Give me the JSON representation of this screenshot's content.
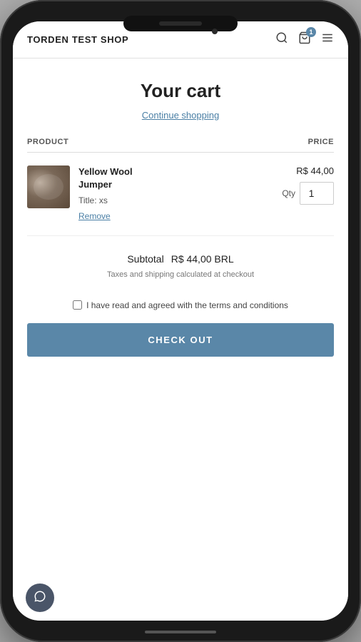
{
  "phone": {
    "speaker_aria": "speaker"
  },
  "header": {
    "logo": "TORDEN TEST SHOP",
    "cart_count": "1",
    "search_aria": "search",
    "cart_aria": "cart",
    "menu_aria": "menu"
  },
  "page": {
    "title": "Your cart",
    "continue_shopping": "Continue shopping"
  },
  "cart_table": {
    "col_product": "PRODUCT",
    "col_price": "PRICE"
  },
  "cart_item": {
    "name_line1": "Yellow Wool",
    "name_line2": "Jumper",
    "variant_label": "Title:",
    "variant_value": "xs",
    "price": "R$ 44,00",
    "qty_label": "Qty",
    "qty_value": "1",
    "remove_label": "Remove"
  },
  "summary": {
    "subtotal_label": "Subtotal",
    "subtotal_value": "R$ 44,00 BRL",
    "taxes_note": "Taxes and shipping calculated at checkout"
  },
  "terms": {
    "text": "I have read and agreed with the terms and conditions"
  },
  "checkout": {
    "button_label": "CHECK OUT"
  }
}
